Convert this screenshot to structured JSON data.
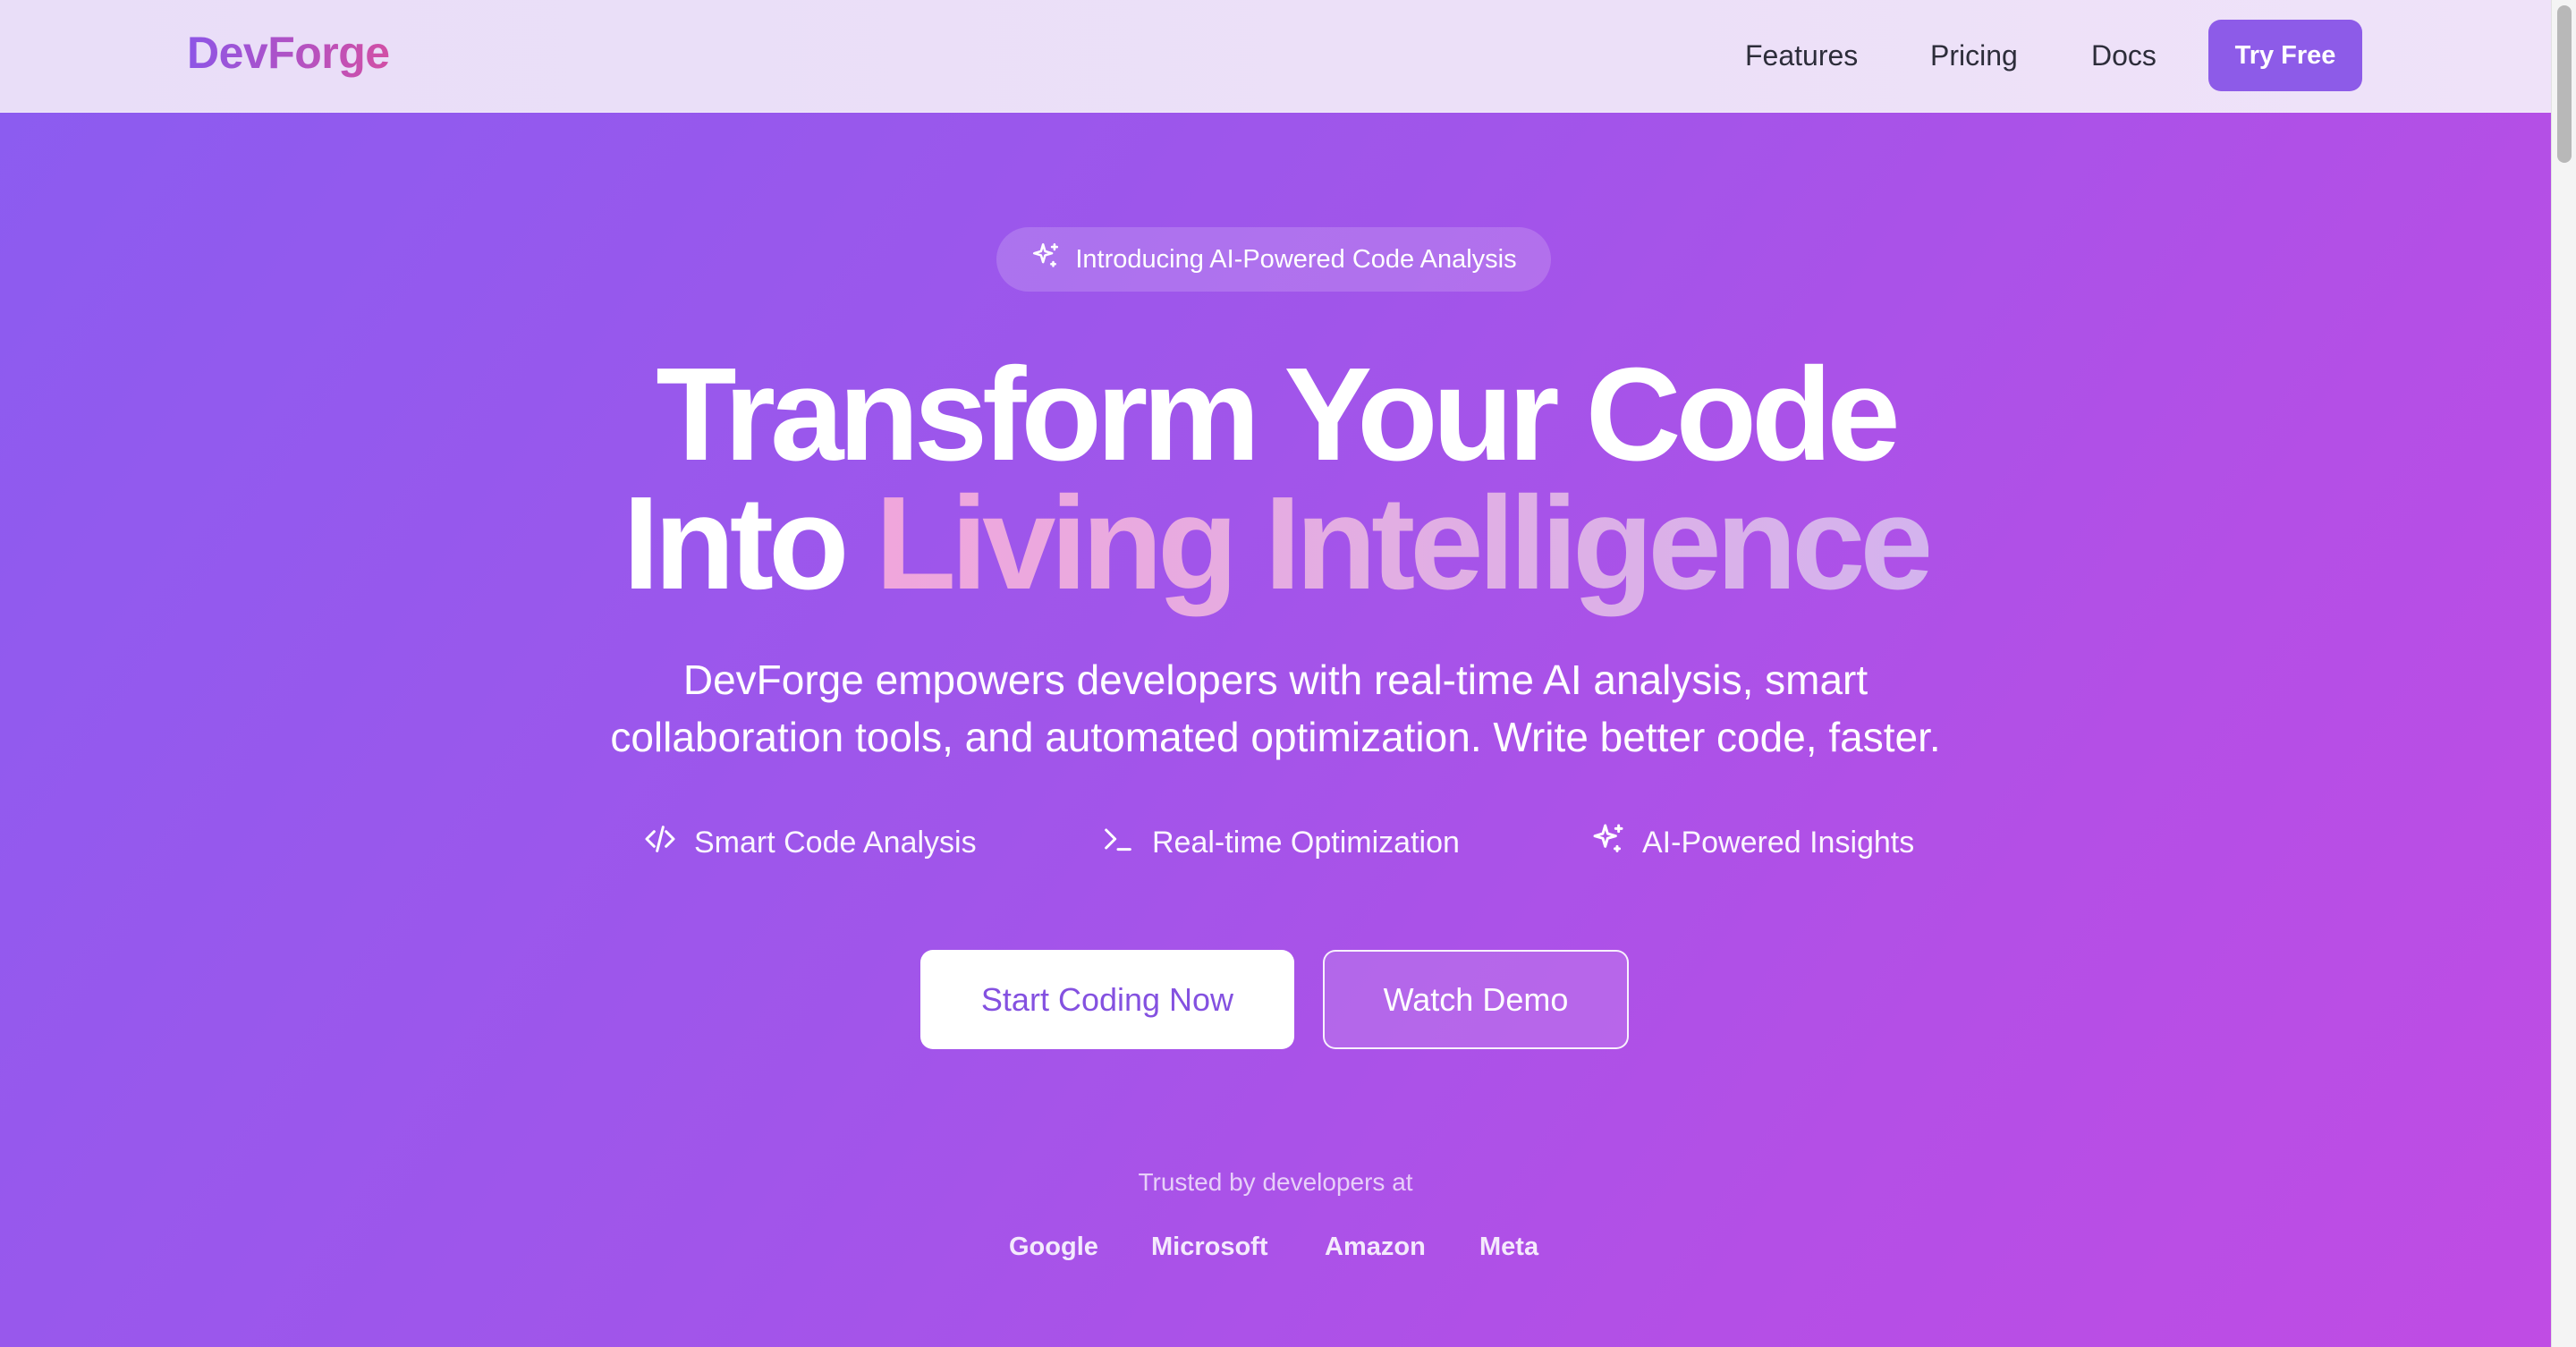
{
  "header": {
    "logo": "DevForge",
    "nav": {
      "features": "Features",
      "pricing": "Pricing",
      "docs": "Docs"
    },
    "cta": "Try Free"
  },
  "hero": {
    "badge": {
      "icon": "sparkles-icon",
      "text": "Introducing AI-Powered Code Analysis"
    },
    "headline": {
      "line1": "Transform Your Code",
      "line2_plain": "Into ",
      "line2_highlight": "Living Intelligence"
    },
    "subtitle": {
      "line1": "DevForge empowers developers with real-time AI analysis, smart",
      "line2": "collaboration tools, and automated optimization. Write better code, faster."
    },
    "features": [
      {
        "icon": "code-icon",
        "label": "Smart Code Analysis"
      },
      {
        "icon": "terminal-icon",
        "label": "Real-time Optimization"
      },
      {
        "icon": "sparkles-icon",
        "label": "AI-Powered Insights"
      }
    ],
    "primary_cta": "Start Coding Now",
    "secondary_cta": "Watch Demo"
  },
  "trusted": {
    "label": "Trusted by developers at",
    "companies": [
      "Google",
      "Microsoft",
      "Amazon",
      "Meta"
    ]
  },
  "colors": {
    "brand": "#8d5be8",
    "gradient_start": "#8b5cf0",
    "gradient_end": "#c04ce4"
  }
}
